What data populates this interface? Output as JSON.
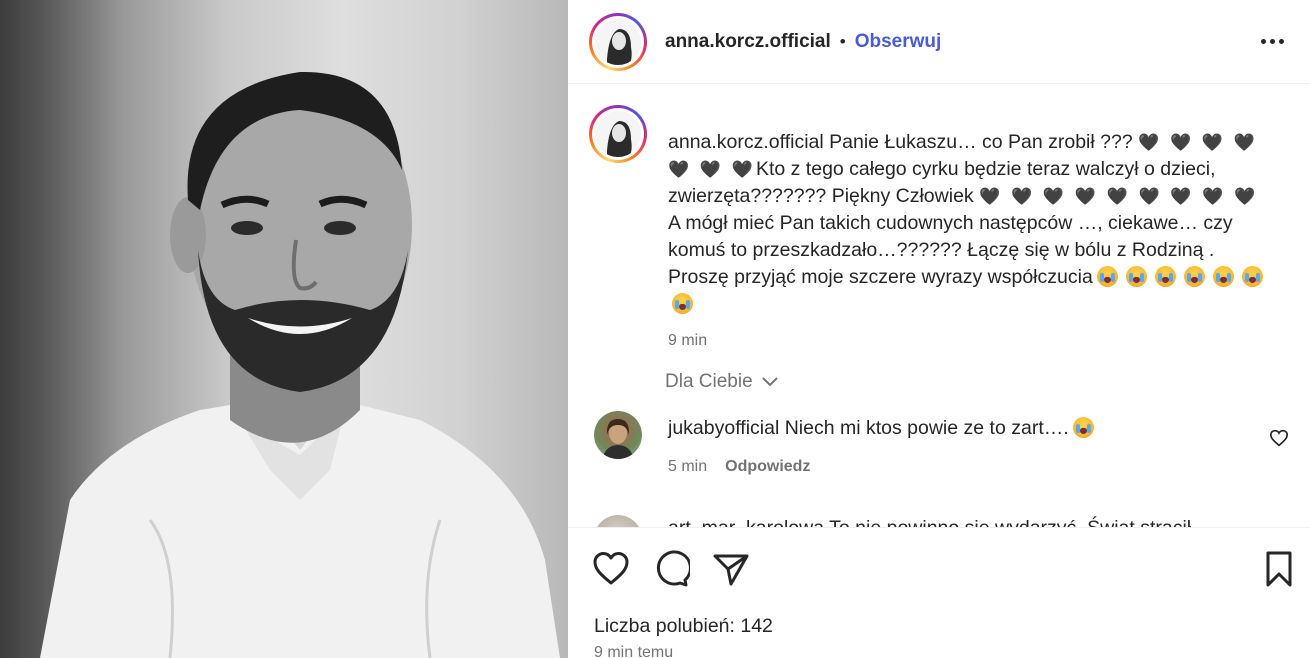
{
  "header": {
    "username": "anna.korcz.official",
    "separator": "•",
    "follow_label": "Obserwuj",
    "more_icon": "more-horizontal-icon"
  },
  "caption": {
    "username": "anna.korcz.official",
    "text_part1": "Panie Łukaszu… co Pan zrobił ???",
    "hearts_a": "🖤 🖤 🖤 🖤",
    "hearts_b": "🖤 🖤 🖤",
    "text_part2": "Kto z tego całego cyrku będzie teraz walczył o dzieci, zwierzęta??????? Piękny Człowiek",
    "hearts_c": "🖤 🖤 🖤 🖤 🖤 🖤 🖤 🖤 🖤",
    "text_part3": "A mógł mieć Pan takich cudownych następców …, ciekawe… czy komuś to przeszkadzało…?????? Łączę się w bólu z Rodziną . Proszę przyjąć moje szczere wyrazy współczucia",
    "time": "9 min"
  },
  "for_you": {
    "label": "Dla Ciebie",
    "icon": "chevron-down-icon"
  },
  "comments": [
    {
      "username": "jukabyofficial",
      "text": "Niech mi ktos powie ze to zart….",
      "time": "5 min",
      "reply_label": "Odpowiedz"
    },
    {
      "username": "art_mar_karolowa",
      "text": "To nie powinno się wydarzyć. Świat stracił"
    }
  ],
  "actions": {
    "like_icon": "heart-icon",
    "comment_icon": "comment-icon",
    "share_icon": "send-icon",
    "save_icon": "bookmark-icon"
  },
  "likes_label": "Liczba polubień: 142",
  "post_time": "9 min temu",
  "colors": {
    "follow": "#4a5bd6",
    "muted": "#737373",
    "text": "#262626"
  }
}
